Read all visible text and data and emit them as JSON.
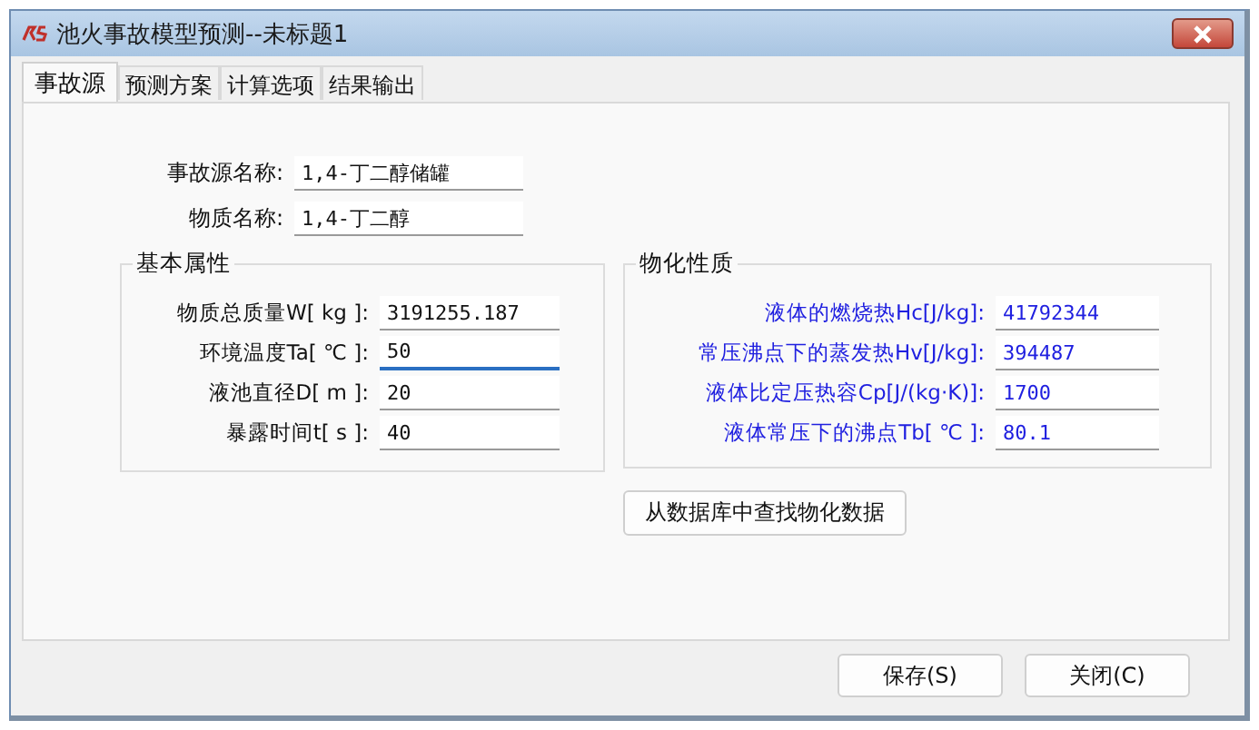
{
  "window": {
    "title": "池火事故模型预测--未标题1"
  },
  "tabs": [
    {
      "label": "事故源",
      "selected": true
    },
    {
      "label": "预测方案",
      "selected": false
    },
    {
      "label": "计算选项",
      "selected": false
    },
    {
      "label": "结果输出",
      "selected": false
    }
  ],
  "source_fields": [
    {
      "label": "事故源名称:",
      "value": "1,4-丁二醇储罐"
    },
    {
      "label": "物质名称:",
      "value": "1,4-丁二醇"
    }
  ],
  "basic_properties": {
    "title": "基本属性",
    "fields": [
      {
        "label": "物质总质量W[ kg ]:",
        "value": "3191255.187",
        "focused": false
      },
      {
        "label": "环境温度Ta[ ℃ ]:",
        "value": "50",
        "focused": true
      },
      {
        "label": "液池直径D[  m ]:",
        "value": "20",
        "focused": false
      },
      {
        "label": "暴露时间t[ s ]:",
        "value": "40",
        "focused": false
      }
    ]
  },
  "physical_properties": {
    "title": "物化性质",
    "fields": [
      {
        "label": "液体的燃烧热Hc[J/kg]:",
        "value": "41792344"
      },
      {
        "label": "常压沸点下的蒸发热Hv[J/kg]:",
        "value": "394487"
      },
      {
        "label": "液体比定压热容Cp[J/(kg·K)]:",
        "value": "1700"
      },
      {
        "label": "液体常压下的沸点Tb[ ℃ ]:",
        "value": "80.1"
      }
    ]
  },
  "lookup_button": "从数据库中查找物化数据",
  "buttons": [
    "保存(S)",
    "关闭(C)"
  ]
}
